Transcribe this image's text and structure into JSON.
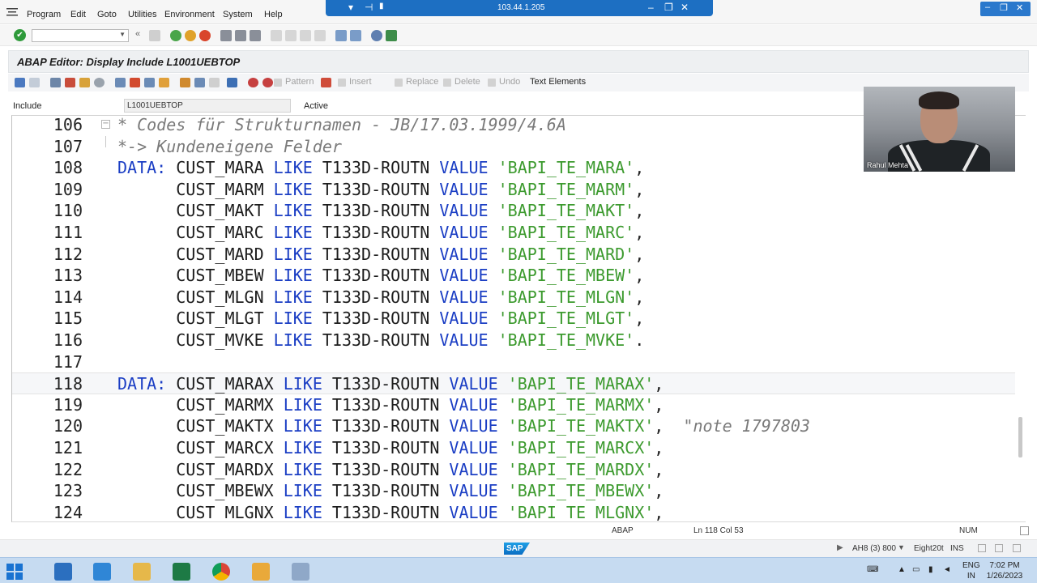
{
  "menubar": {
    "items": [
      "Program",
      "Edit",
      "Goto",
      "Utilities",
      "Environment",
      "System",
      "Help"
    ]
  },
  "remote_session": {
    "ip": "103.44.1.205"
  },
  "toolbar": {
    "command_value": "",
    "command_placeholder": ""
  },
  "title": {
    "text": "ABAP Editor: Display Include L1001UEBTOP"
  },
  "app_toolbar": {
    "pattern": "Pattern",
    "insert": "Insert",
    "replace": "Replace",
    "delete": "Delete",
    "undo": "Undo",
    "text_elements": "Text Elements"
  },
  "include": {
    "label": "Include",
    "value": "L1001UEBTOP",
    "status": "Active"
  },
  "editor": {
    "lines": [
      {
        "no": "106",
        "tokens": [
          {
            "t": "* Codes für Strukturnamen - JB/17.03.1999/4.6A",
            "c": "cmt"
          }
        ]
      },
      {
        "no": "107",
        "tokens": [
          {
            "t": "*-> Kundeneigene Felder",
            "c": "cmt"
          }
        ]
      },
      {
        "no": "108",
        "tokens": [
          {
            "t": "DATA: ",
            "c": "kw"
          },
          {
            "t": "CUST_MARA ",
            "c": "id"
          },
          {
            "t": "LIKE ",
            "c": "kw"
          },
          {
            "t": "T133D-ROUTN ",
            "c": "id"
          },
          {
            "t": "VALUE ",
            "c": "kw"
          },
          {
            "t": "'BAPI_TE_MARA'",
            "c": "str"
          },
          {
            "t": ",",
            "c": "punc"
          }
        ]
      },
      {
        "no": "109",
        "tokens": [
          {
            "t": "      ",
            "c": "id"
          },
          {
            "t": "CUST_MARM ",
            "c": "id"
          },
          {
            "t": "LIKE ",
            "c": "kw"
          },
          {
            "t": "T133D-ROUTN ",
            "c": "id"
          },
          {
            "t": "VALUE ",
            "c": "kw"
          },
          {
            "t": "'BAPI_TE_MARM'",
            "c": "str"
          },
          {
            "t": ",",
            "c": "punc"
          }
        ]
      },
      {
        "no": "110",
        "tokens": [
          {
            "t": "      ",
            "c": "id"
          },
          {
            "t": "CUST_MAKT ",
            "c": "id"
          },
          {
            "t": "LIKE ",
            "c": "kw"
          },
          {
            "t": "T133D-ROUTN ",
            "c": "id"
          },
          {
            "t": "VALUE ",
            "c": "kw"
          },
          {
            "t": "'BAPI_TE_MAKT'",
            "c": "str"
          },
          {
            "t": ",",
            "c": "punc"
          }
        ]
      },
      {
        "no": "111",
        "tokens": [
          {
            "t": "      ",
            "c": "id"
          },
          {
            "t": "CUST_MARC ",
            "c": "id"
          },
          {
            "t": "LIKE ",
            "c": "kw"
          },
          {
            "t": "T133D-ROUTN ",
            "c": "id"
          },
          {
            "t": "VALUE ",
            "c": "kw"
          },
          {
            "t": "'BAPI_TE_MARC'",
            "c": "str"
          },
          {
            "t": ",",
            "c": "punc"
          }
        ]
      },
      {
        "no": "112",
        "tokens": [
          {
            "t": "      ",
            "c": "id"
          },
          {
            "t": "CUST_MARD ",
            "c": "id"
          },
          {
            "t": "LIKE ",
            "c": "kw"
          },
          {
            "t": "T133D-ROUTN ",
            "c": "id"
          },
          {
            "t": "VALUE ",
            "c": "kw"
          },
          {
            "t": "'BAPI_TE_MARD'",
            "c": "str"
          },
          {
            "t": ",",
            "c": "punc"
          }
        ]
      },
      {
        "no": "113",
        "tokens": [
          {
            "t": "      ",
            "c": "id"
          },
          {
            "t": "CUST_MBEW ",
            "c": "id"
          },
          {
            "t": "LIKE ",
            "c": "kw"
          },
          {
            "t": "T133D-ROUTN ",
            "c": "id"
          },
          {
            "t": "VALUE ",
            "c": "kw"
          },
          {
            "t": "'BAPI_TE_MBEW'",
            "c": "str"
          },
          {
            "t": ",",
            "c": "punc"
          }
        ]
      },
      {
        "no": "114",
        "tokens": [
          {
            "t": "      ",
            "c": "id"
          },
          {
            "t": "CUST_MLGN ",
            "c": "id"
          },
          {
            "t": "LIKE ",
            "c": "kw"
          },
          {
            "t": "T133D-ROUTN ",
            "c": "id"
          },
          {
            "t": "VALUE ",
            "c": "kw"
          },
          {
            "t": "'BAPI_TE_MLGN'",
            "c": "str"
          },
          {
            "t": ",",
            "c": "punc"
          }
        ]
      },
      {
        "no": "115",
        "tokens": [
          {
            "t": "      ",
            "c": "id"
          },
          {
            "t": "CUST_MLGT ",
            "c": "id"
          },
          {
            "t": "LIKE ",
            "c": "kw"
          },
          {
            "t": "T133D-ROUTN ",
            "c": "id"
          },
          {
            "t": "VALUE ",
            "c": "kw"
          },
          {
            "t": "'BAPI_TE_MLGT'",
            "c": "str"
          },
          {
            "t": ",",
            "c": "punc"
          }
        ]
      },
      {
        "no": "116",
        "tokens": [
          {
            "t": "      ",
            "c": "id"
          },
          {
            "t": "CUST_MVKE ",
            "c": "id"
          },
          {
            "t": "LIKE ",
            "c": "kw"
          },
          {
            "t": "T133D-ROUTN ",
            "c": "id"
          },
          {
            "t": "VALUE ",
            "c": "kw"
          },
          {
            "t": "'BAPI_TE_MVKE'",
            "c": "str"
          },
          {
            "t": ".",
            "c": "punc"
          }
        ]
      },
      {
        "no": "117",
        "tokens": []
      },
      {
        "no": "118",
        "tokens": [
          {
            "t": "DATA: ",
            "c": "kw"
          },
          {
            "t": "CUST_MARAX ",
            "c": "id"
          },
          {
            "t": "LIKE ",
            "c": "kw"
          },
          {
            "t": "T133D-ROUTN ",
            "c": "id"
          },
          {
            "t": "VALUE ",
            "c": "kw"
          },
          {
            "t": "'BAPI_TE_MARAX'",
            "c": "str"
          },
          {
            "t": ",",
            "c": "punc"
          }
        ]
      },
      {
        "no": "119",
        "tokens": [
          {
            "t": "      ",
            "c": "id"
          },
          {
            "t": "CUST_MARMX ",
            "c": "id"
          },
          {
            "t": "LIKE ",
            "c": "kw"
          },
          {
            "t": "T133D-ROUTN ",
            "c": "id"
          },
          {
            "t": "VALUE ",
            "c": "kw"
          },
          {
            "t": "'BAPI_TE_MARMX'",
            "c": "str"
          },
          {
            "t": ",",
            "c": "punc"
          }
        ]
      },
      {
        "no": "120",
        "tokens": [
          {
            "t": "      ",
            "c": "id"
          },
          {
            "t": "CUST_MAKTX ",
            "c": "id"
          },
          {
            "t": "LIKE ",
            "c": "kw"
          },
          {
            "t": "T133D-ROUTN ",
            "c": "id"
          },
          {
            "t": "VALUE ",
            "c": "kw"
          },
          {
            "t": "'BAPI_TE_MAKTX'",
            "c": "str"
          },
          {
            "t": ",  ",
            "c": "punc"
          },
          {
            "t": "\"note 1797803",
            "c": "cmt"
          }
        ]
      },
      {
        "no": "121",
        "tokens": [
          {
            "t": "      ",
            "c": "id"
          },
          {
            "t": "CUST_MARCX ",
            "c": "id"
          },
          {
            "t": "LIKE ",
            "c": "kw"
          },
          {
            "t": "T133D-ROUTN ",
            "c": "id"
          },
          {
            "t": "VALUE ",
            "c": "kw"
          },
          {
            "t": "'BAPI_TE_MARCX'",
            "c": "str"
          },
          {
            "t": ",",
            "c": "punc"
          }
        ]
      },
      {
        "no": "122",
        "tokens": [
          {
            "t": "      ",
            "c": "id"
          },
          {
            "t": "CUST_MARDX ",
            "c": "id"
          },
          {
            "t": "LIKE ",
            "c": "kw"
          },
          {
            "t": "T133D-ROUTN ",
            "c": "id"
          },
          {
            "t": "VALUE ",
            "c": "kw"
          },
          {
            "t": "'BAPI_TE_MARDX'",
            "c": "str"
          },
          {
            "t": ",",
            "c": "punc"
          }
        ]
      },
      {
        "no": "123",
        "tokens": [
          {
            "t": "      ",
            "c": "id"
          },
          {
            "t": "CUST_MBEWX ",
            "c": "id"
          },
          {
            "t": "LIKE ",
            "c": "kw"
          },
          {
            "t": "T133D-ROUTN ",
            "c": "id"
          },
          {
            "t": "VALUE ",
            "c": "kw"
          },
          {
            "t": "'BAPI_TE_MBEWX'",
            "c": "str"
          },
          {
            "t": ",",
            "c": "punc"
          }
        ]
      },
      {
        "no": "124",
        "tokens": [
          {
            "t": "      ",
            "c": "id"
          },
          {
            "t": "CUST_MLGNX ",
            "c": "id"
          },
          {
            "t": "LIKE ",
            "c": "kw"
          },
          {
            "t": "T133D-ROUTN ",
            "c": "id"
          },
          {
            "t": "VALUE ",
            "c": "kw"
          },
          {
            "t": "'BAPI_TE_MLGNX'",
            "c": "str"
          },
          {
            "t": ",",
            "c": "punc"
          }
        ]
      }
    ],
    "current_line": "118"
  },
  "video": {
    "presenter_name": "Rahul Mehta"
  },
  "statusbar": {
    "language": "ABAP",
    "cursor_position": "Ln 118 Col 53",
    "num_lock": "NUM"
  },
  "sap_footer": {
    "logo": "SAP",
    "system": "AH8 (3) 800",
    "host": "Eight20t",
    "mode": "INS"
  },
  "taskbar": {
    "language_top": "ENG",
    "language_bottom": "IN",
    "time": "7:02 PM",
    "date": "1/26/2023"
  },
  "colors": {
    "keyword": "#1b3ec4",
    "string": "#3c9a2e",
    "comment": "#7a7a7a",
    "remote_bar": "#1d6fc2"
  }
}
